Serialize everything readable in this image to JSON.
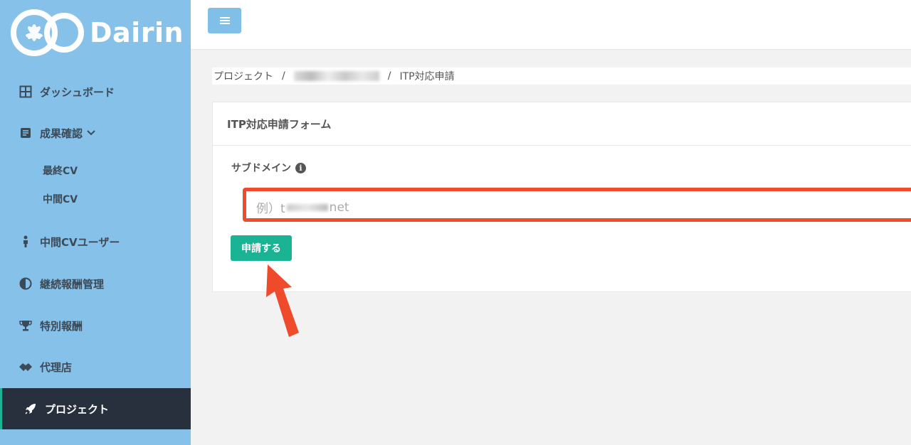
{
  "logo": {
    "text": "Dairin"
  },
  "nav": {
    "dashboard": {
      "label": "ダッシュボード",
      "icon": "grid-icon"
    },
    "results": {
      "label": "成果確認",
      "icon": "document-icon"
    },
    "results_sub": [
      {
        "label": "最終CV"
      },
      {
        "label": "中間CV"
      }
    ],
    "mid_cv_users": {
      "label": "中間CVユーザー",
      "icon": "person-icon"
    },
    "continuous_reward": {
      "label": "継続報酬管理",
      "icon": "half-circle-icon"
    },
    "special_reward": {
      "label": "特別報酬",
      "icon": "trophy-icon"
    },
    "agency": {
      "label": "代理店",
      "icon": "handshake-icon"
    },
    "project": {
      "label": "プロジェクト",
      "icon": "rocket-icon"
    }
  },
  "breadcrumb": {
    "root": "プロジェクト",
    "separator": "/",
    "current": "ITP対応申請"
  },
  "form": {
    "title": "ITP対応申請フォーム",
    "subdomain_label": "サブドメイン",
    "info_glyph": "i",
    "placeholder_prefix": "例）t",
    "placeholder_suffix": "net",
    "submit_label": "申請する"
  },
  "colors": {
    "sidebar_bg": "#86c1ea",
    "active_bg": "#27303c",
    "primary": "#1ab394",
    "highlight": "#ef4a2b"
  }
}
